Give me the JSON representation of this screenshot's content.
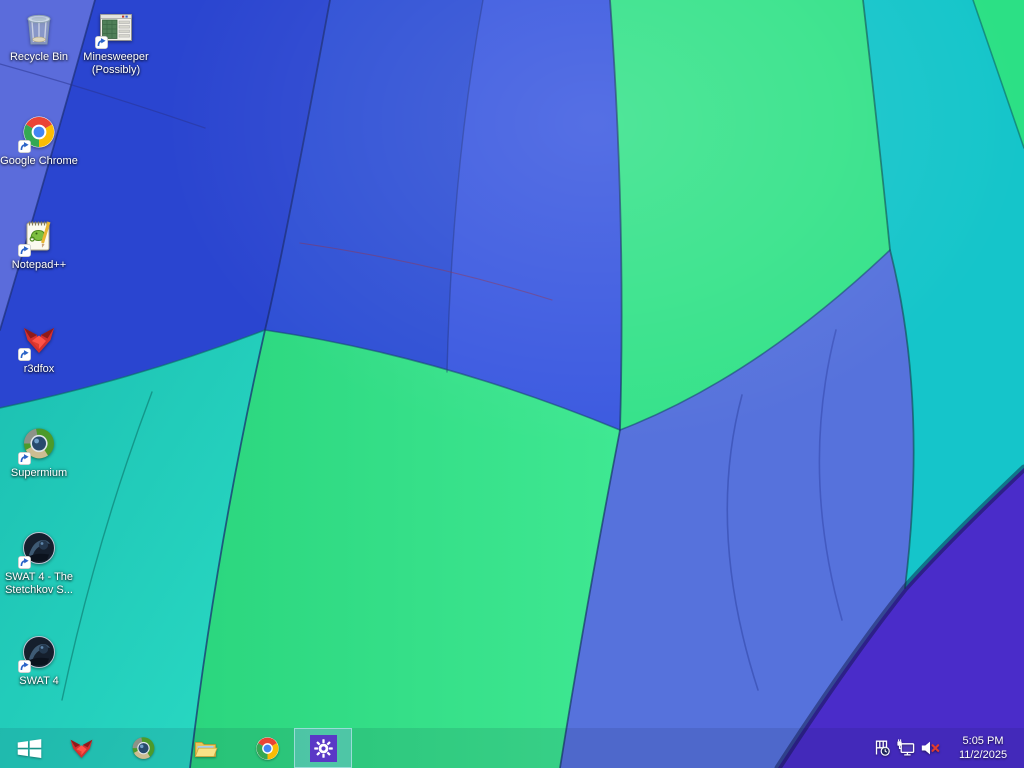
{
  "desktop": {
    "icons": [
      {
        "label": "Recycle Bin",
        "icon": "recycle-bin",
        "shortcut": false,
        "column": 1
      },
      {
        "label": "Minesweeper (Possibly)",
        "icon": "minesweeper",
        "shortcut": true,
        "column": 2
      },
      {
        "label": "Google Chrome",
        "icon": "chrome",
        "shortcut": true,
        "column": 1
      },
      {
        "label": "Notepad++",
        "icon": "notepadpp",
        "shortcut": true,
        "column": 1
      },
      {
        "label": "r3dfox",
        "icon": "r3dfox",
        "shortcut": true,
        "column": 1
      },
      {
        "label": "Supermium",
        "icon": "supermium",
        "shortcut": true,
        "column": 1
      },
      {
        "label": "SWAT 4 - The Stetchkov S...",
        "icon": "swat4",
        "shortcut": true,
        "column": 1
      },
      {
        "label": "SWAT 4",
        "icon": "swat4",
        "shortcut": true,
        "column": 1
      }
    ]
  },
  "taskbar": {
    "start_label": "Start",
    "pinned": [
      {
        "name": "r3dfox",
        "icon": "r3dfox",
        "active": false
      },
      {
        "name": "Supermium",
        "icon": "supermium",
        "active": false
      },
      {
        "name": "File Explorer",
        "icon": "explorer",
        "active": false
      },
      {
        "name": "Google Chrome",
        "icon": "chrome",
        "active": false
      },
      {
        "name": "Settings",
        "icon": "settings",
        "active": true
      }
    ]
  },
  "tray": {
    "icons": [
      {
        "name": "action-center-flag",
        "icon": "flag"
      },
      {
        "name": "network",
        "icon": "network"
      },
      {
        "name": "volume-muted",
        "icon": "volume-muted"
      }
    ],
    "time": "5:05 PM",
    "date": "11/2/2025"
  },
  "colors": {
    "settings_tile": "#5a38c6",
    "balloon_blue": "#2f50d5",
    "balloon_periwinkle": "#5b6cdb",
    "balloon_teal": "#1fc9b8",
    "balloon_green": "#32dd86",
    "balloon_cyan": "#15c5ca",
    "balloon_purple": "#4a2cc9"
  }
}
